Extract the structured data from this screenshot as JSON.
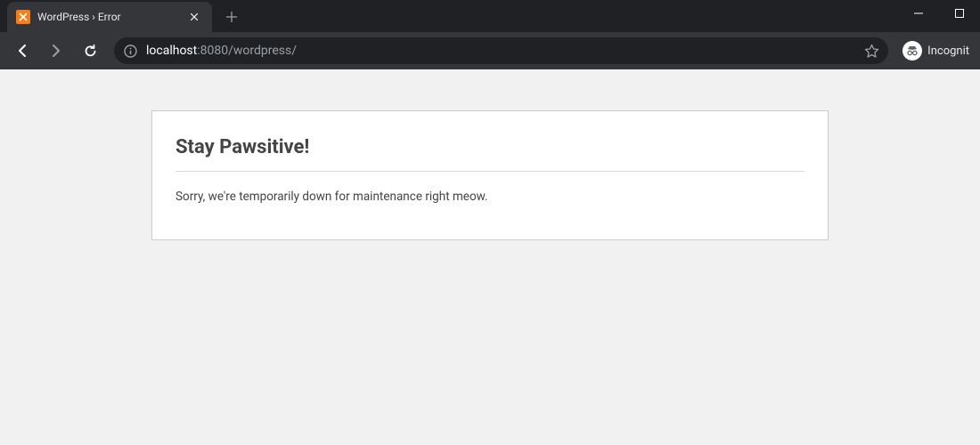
{
  "browser": {
    "tab_title": "WordPress › Error",
    "url_host": "localhost",
    "url_port_path": ":8080/wordpress/",
    "incognito_label": "Incognit"
  },
  "page": {
    "heading": "Stay Pawsitive!",
    "message": "Sorry, we're temporarily down for maintenance right meow."
  }
}
